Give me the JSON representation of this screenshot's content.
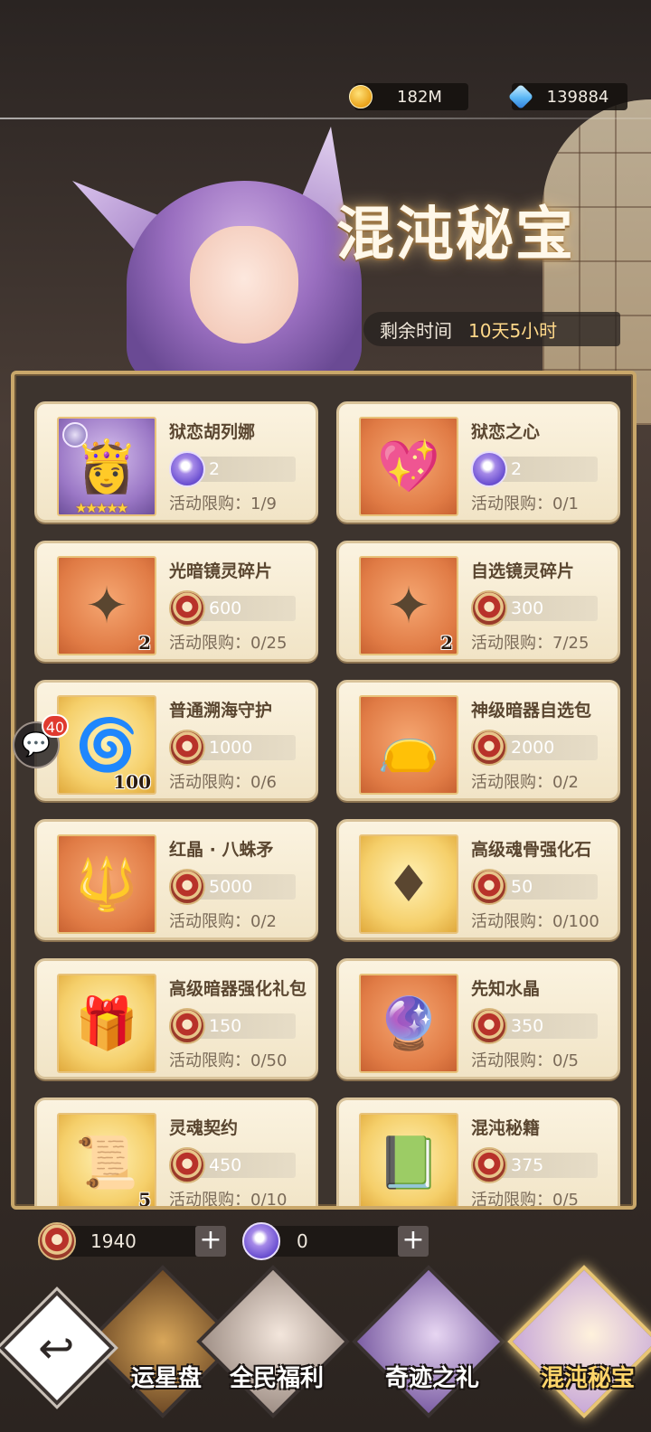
{
  "header": {
    "gold": "182M",
    "gems": "139884",
    "title": "混沌秘宝",
    "timer_label": "剩余时间",
    "timer_value": "10天5小时"
  },
  "items": [
    {
      "name": "狱恋胡列娜",
      "price": "2",
      "limit": "活动限购：1/9",
      "thumb": "purple",
      "coin": "orb",
      "qty": "",
      "stars": "★★★★★",
      "icon": "character-portrait-icon"
    },
    {
      "name": "狱恋之心",
      "price": "2",
      "limit": "活动限购：0/1",
      "thumb": "orange",
      "coin": "orb",
      "qty": "",
      "stars": "",
      "icon": "winged-heart-icon"
    },
    {
      "name": "光暗镜灵碎片",
      "price": "600",
      "limit": "活动限购：0/25",
      "thumb": "orange",
      "coin": "medal",
      "qty": "2",
      "stars": "",
      "icon": "crystal-star-icon"
    },
    {
      "name": "自选镜灵碎片",
      "price": "300",
      "limit": "活动限购：7/25",
      "thumb": "orange",
      "coin": "medal",
      "qty": "2",
      "stars": "",
      "icon": "crystal-star-icon"
    },
    {
      "name": "普通溯海守护",
      "price": "1000",
      "limit": "活动限购：0/6",
      "thumb": "gold",
      "coin": "medal",
      "qty": "100",
      "stars": "",
      "icon": "blue-rune-icon"
    },
    {
      "name": "神级暗器自选包",
      "price": "2000",
      "limit": "活动限购：0/2",
      "thumb": "orange",
      "coin": "medal",
      "qty": "",
      "stars": "",
      "icon": "gift-bag-icon"
    },
    {
      "name": "红晶 · 八蛛矛",
      "price": "5000",
      "limit": "活动限购：0/2",
      "thumb": "orange",
      "coin": "medal",
      "qty": "",
      "stars": "",
      "icon": "red-spider-spear-icon"
    },
    {
      "name": "高级魂骨强化石",
      "price": "50",
      "limit": "活动限购：0/100",
      "thumb": "gold",
      "coin": "medal",
      "qty": "",
      "stars": "",
      "icon": "red-crystal-icon"
    },
    {
      "name": "高级暗器强化礼包",
      "price": "150",
      "limit": "活动限购：0/50",
      "thumb": "gold",
      "coin": "medal",
      "qty": "",
      "stars": "",
      "icon": "red-gift-bag-icon"
    },
    {
      "name": "先知水晶",
      "price": "350",
      "limit": "活动限购：0/5",
      "thumb": "orange",
      "coin": "medal",
      "qty": "",
      "stars": "",
      "icon": "crystal-ball-icon"
    },
    {
      "name": "灵魂契约",
      "price": "450",
      "limit": "活动限购：0/10",
      "thumb": "gold",
      "coin": "medal",
      "qty": "5",
      "stars": "",
      "icon": "contract-card-icon"
    },
    {
      "name": "混沌秘籍",
      "price": "375",
      "limit": "活动限购：0/5",
      "thumb": "gold",
      "coin": "medal",
      "qty": "",
      "stars": "",
      "icon": "mystery-book-icon"
    }
  ],
  "chat": {
    "badge": "40"
  },
  "bottom_currency": [
    {
      "value": "1940",
      "plus": "+"
    },
    {
      "value": "0",
      "plus": "+"
    }
  ],
  "tabs": [
    {
      "label": "运星盘",
      "active": false
    },
    {
      "label": "全民福利",
      "active": false
    },
    {
      "label": "奇迹之礼",
      "active": false
    },
    {
      "label": "混沌秘宝",
      "active": true
    }
  ],
  "colors": {
    "accent_gold": "#ffd56a",
    "panel_border": "#c9a76a",
    "card_bg": "#fbf3e0"
  }
}
